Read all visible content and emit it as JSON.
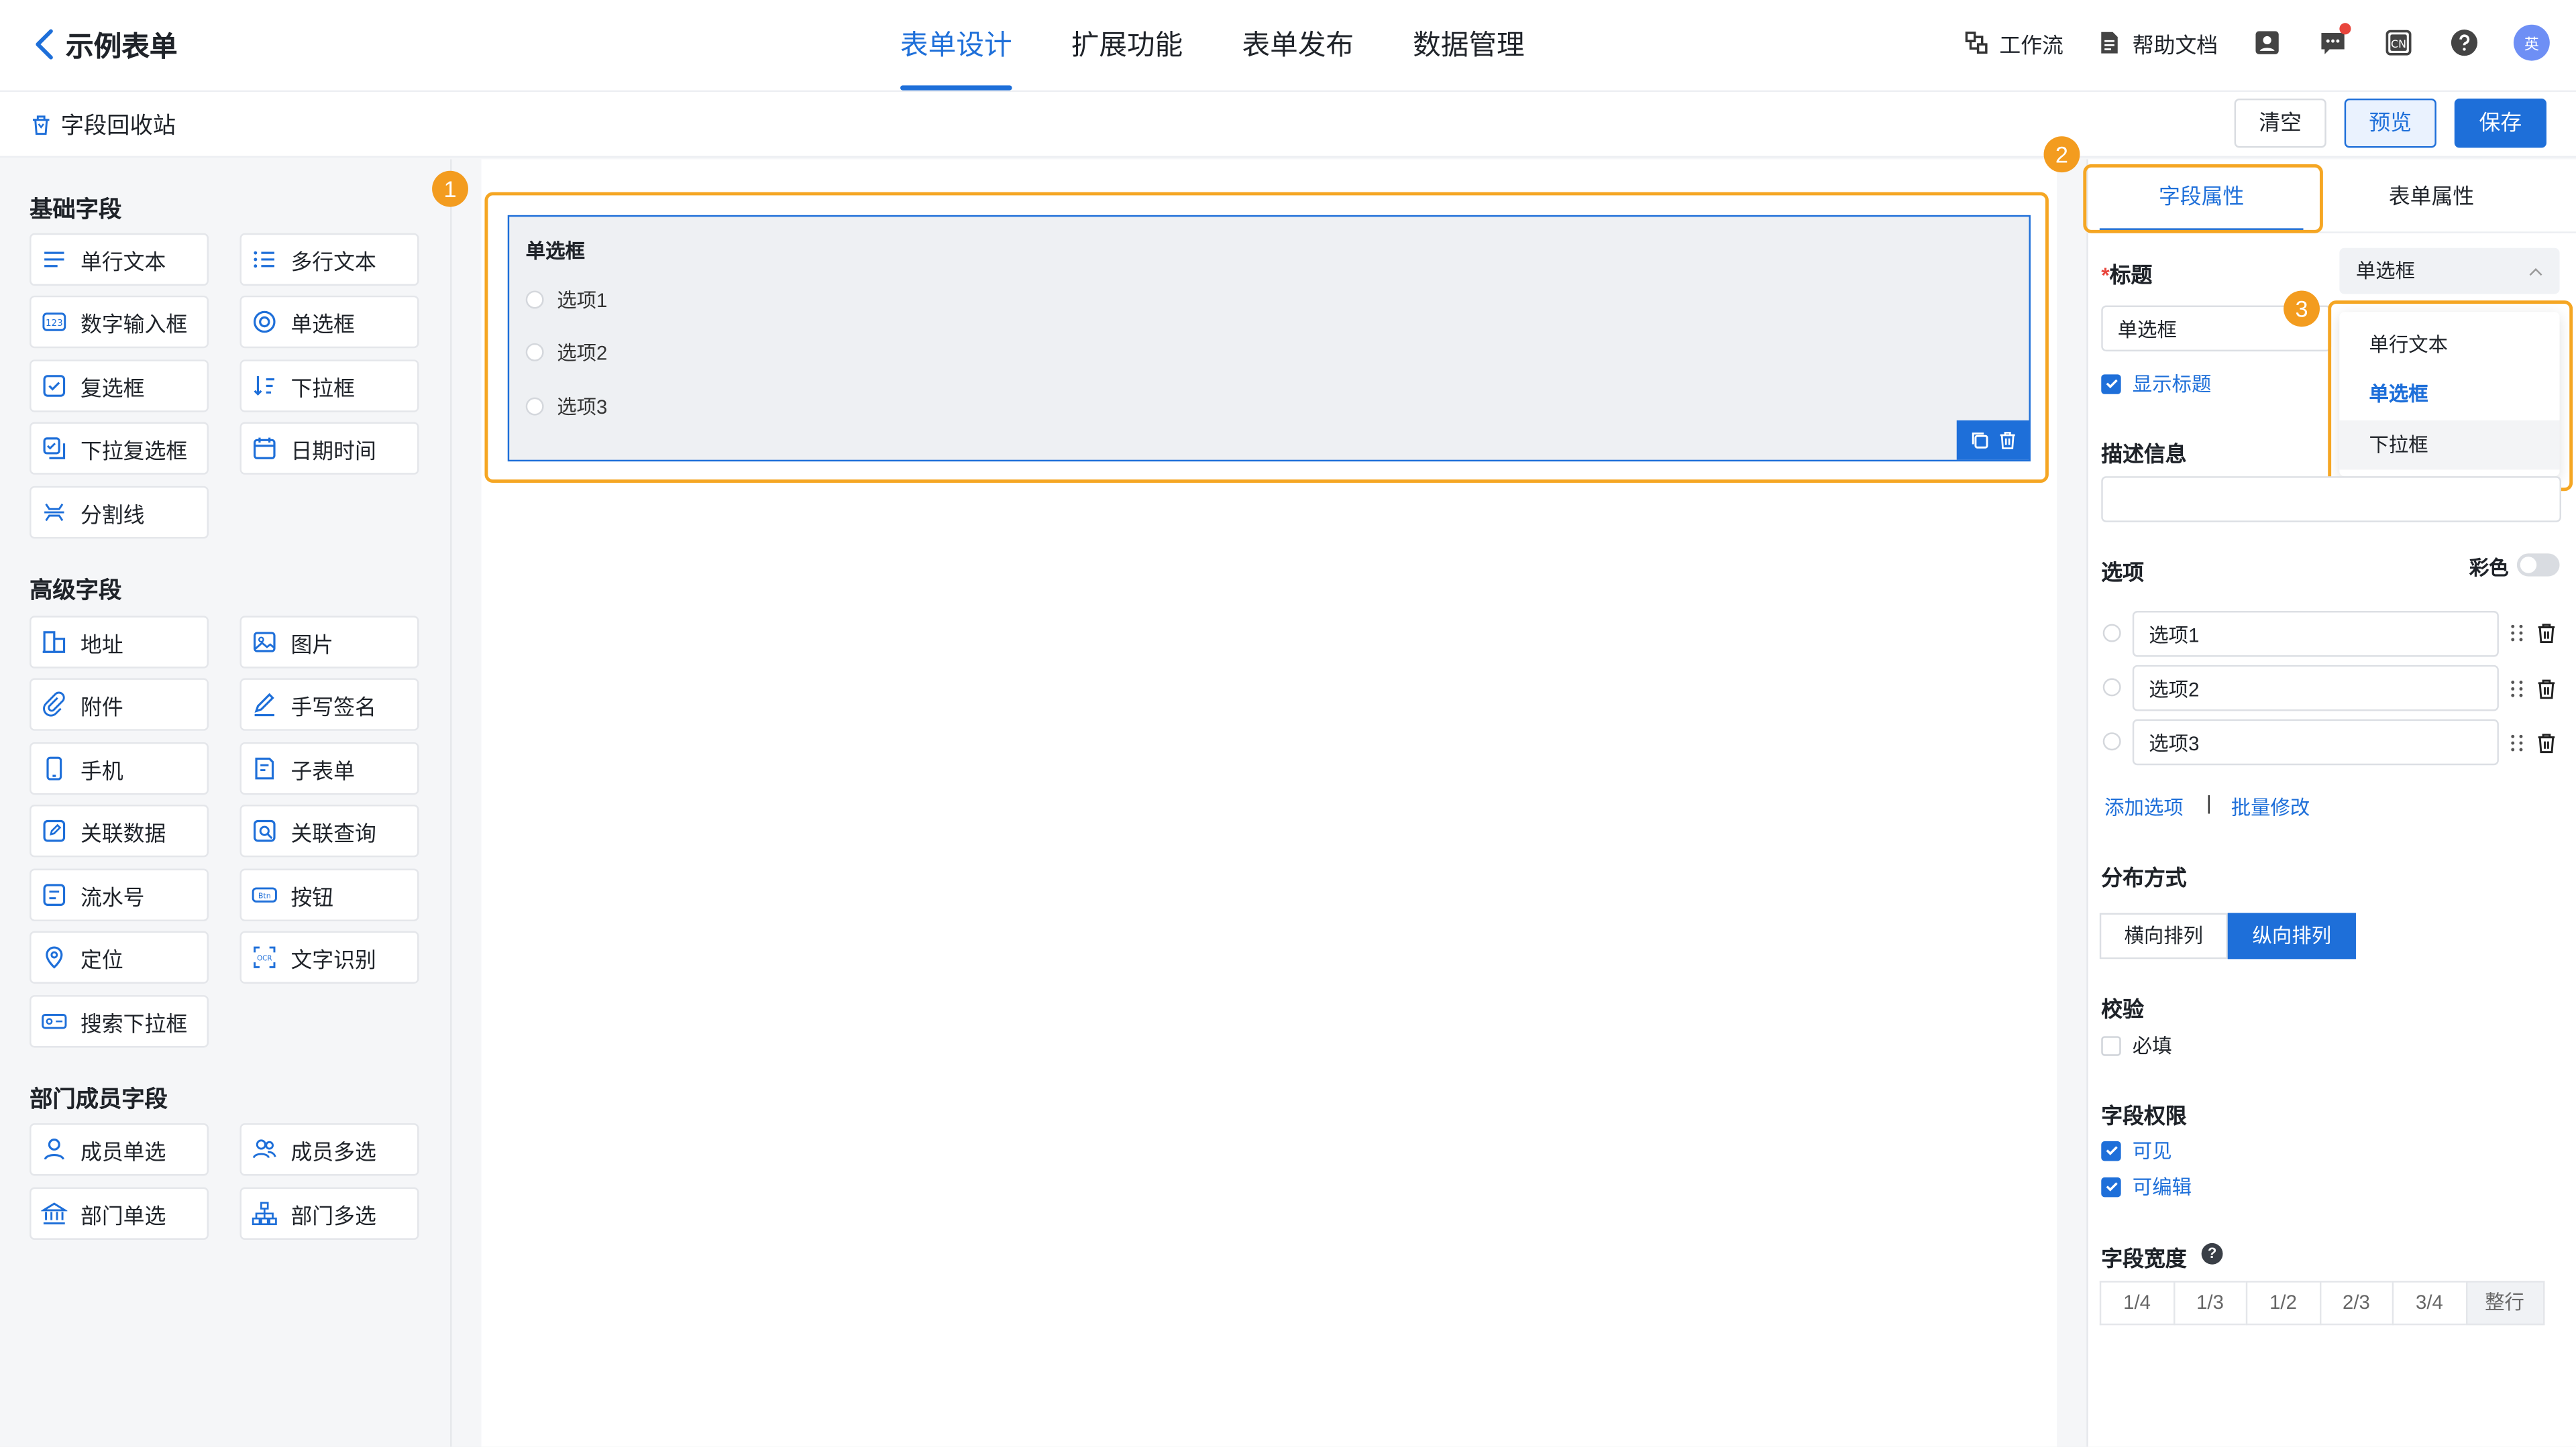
{
  "header": {
    "app_title": "示例表单",
    "tabs": [
      {
        "label": "表单设计",
        "active": true
      },
      {
        "label": "扩展功能",
        "active": false
      },
      {
        "label": "表单发布",
        "active": false
      },
      {
        "label": "数据管理",
        "active": false
      }
    ],
    "workflow_label": "工作流",
    "help_label": "帮助文档",
    "lang_icon_text": "CN",
    "avatar_text": "英",
    "accent_color": "#1e6fd9"
  },
  "subbar": {
    "recycle_label": "字段回收站",
    "clear_label": "清空",
    "preview_label": "预览",
    "save_label": "保存"
  },
  "palette": {
    "basic_title": "基础字段",
    "basic_items": [
      "单行文本",
      "多行文本",
      "数字输入框",
      "单选框",
      "复选框",
      "下拉框",
      "下拉复选框",
      "日期时间",
      "分割线"
    ],
    "advanced_title": "高级字段",
    "advanced_items": [
      "地址",
      "图片",
      "附件",
      "手写签名",
      "手机",
      "子表单",
      "关联数据",
      "关联查询",
      "流水号",
      "按钮",
      "定位",
      "文字识别",
      "搜索下拉框"
    ],
    "member_title": "部门成员字段",
    "member_items": [
      "成员单选",
      "成员多选",
      "部门单选",
      "部门多选"
    ]
  },
  "badges": [
    "1",
    "2",
    "3"
  ],
  "canvas": {
    "field_title": "单选框",
    "options": [
      "选项1",
      "选项2",
      "选项3"
    ]
  },
  "props": {
    "tab_field": "字段属性",
    "tab_form": "表单属性",
    "title_label": "标题",
    "required_star": "*",
    "type_select_value": "单选框",
    "title_input_value": "单选框",
    "show_title_label": "显示标题",
    "desc_label": "描述信息",
    "desc_value": "",
    "options_label": "选项",
    "colorful_label": "彩色",
    "options": [
      "选项1",
      "选项2",
      "选项3"
    ],
    "add_option": "添加选项",
    "separator": "|",
    "batch_edit": "批量修改",
    "layout_label": "分布方式",
    "layout_horizontal": "横向排列",
    "layout_vertical": "纵向排列",
    "validate_label": "校验",
    "required_label": "必填",
    "perm_label": "字段权限",
    "visible_label": "可见",
    "editable_label": "可编辑",
    "width_label": "字段宽度",
    "help_mark": "?",
    "width_options": [
      "1/4",
      "1/3",
      "1/2",
      "2/3",
      "3/4",
      "整行"
    ]
  },
  "dropdown": {
    "items": [
      "单行文本",
      "单选框",
      "下拉框"
    ],
    "selected": "单选框"
  },
  "highlight_color": "#f5a623"
}
